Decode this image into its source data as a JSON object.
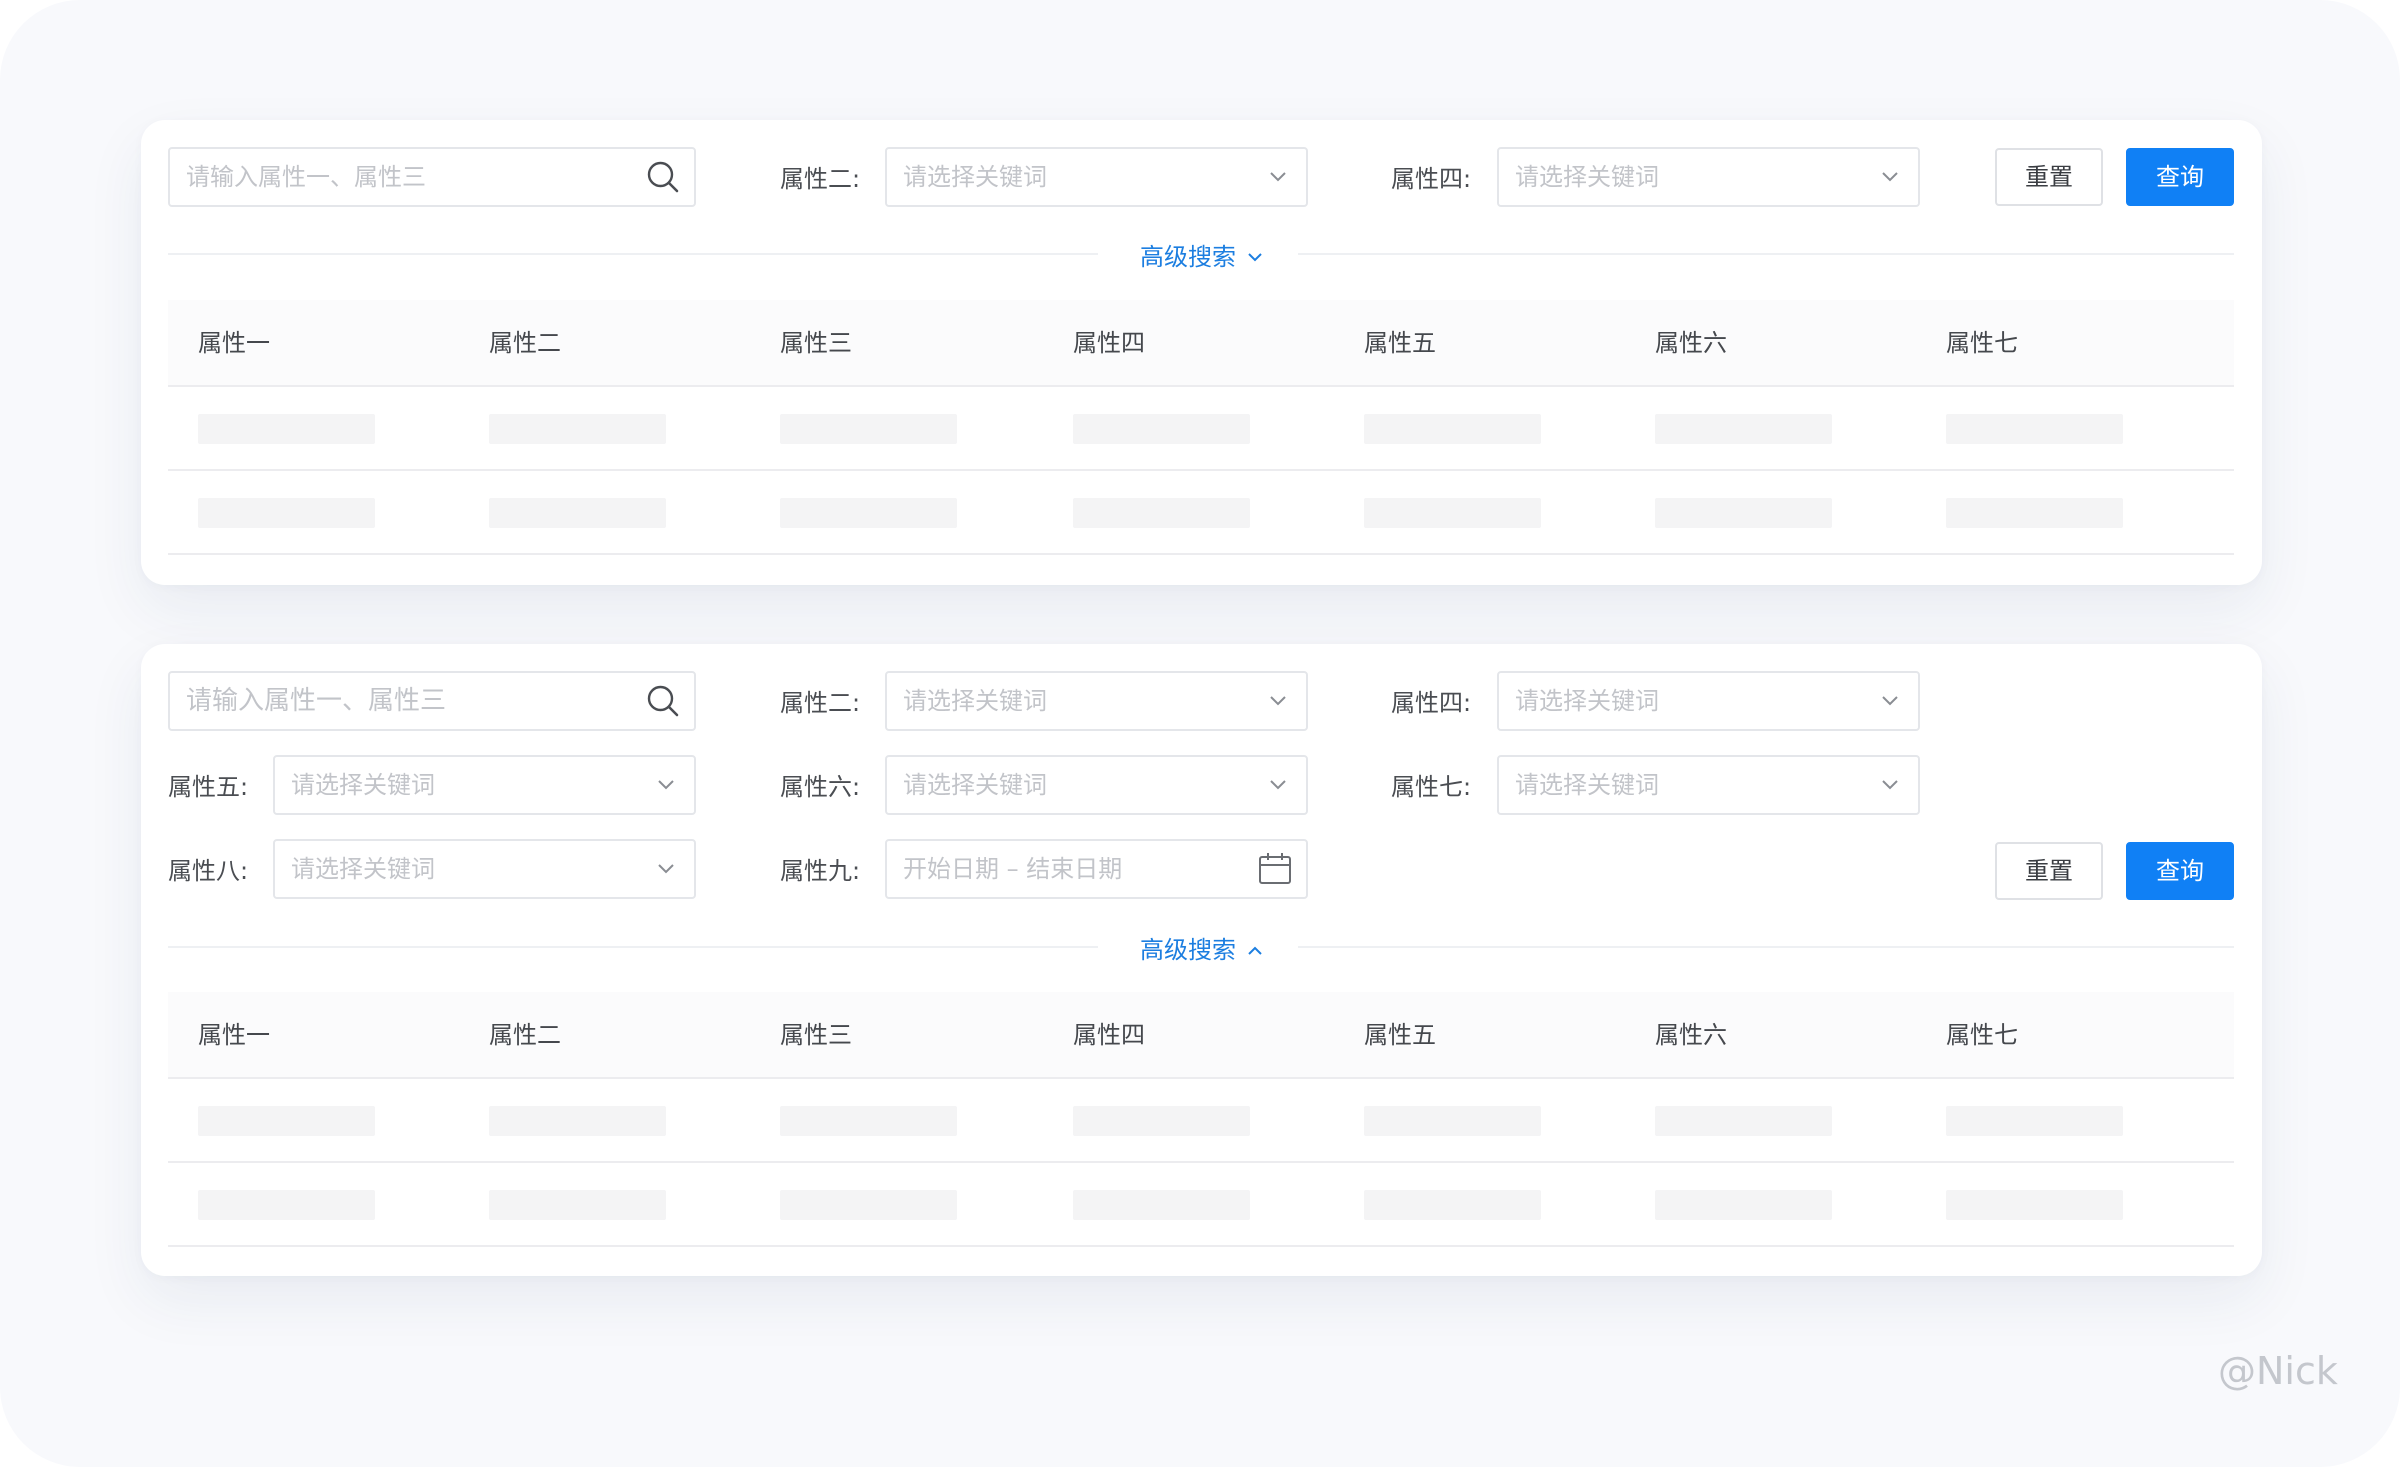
{
  "search_placeholder": "请输入属性一、属性三",
  "select_placeholder": "请选择关键词",
  "date_range_placeholder": "开始日期 – 结束日期",
  "labels": {
    "attr2": "属性二:",
    "attr4": "属性四:",
    "attr5": "属性五:",
    "attr6": "属性六:",
    "attr7": "属性七:",
    "attr8": "属性八:",
    "attr9": "属性九:"
  },
  "buttons": {
    "reset": "重置",
    "query": "查询"
  },
  "advanced_search": {
    "label": "高级搜索",
    "collapsed_icon": "chevron-down-icon",
    "expanded_icon": "chevron-up-icon"
  },
  "table": {
    "columns": [
      "属性一",
      "属性二",
      "属性三",
      "属性四",
      "属性五",
      "属性六",
      "属性七"
    ],
    "row_count": 2
  },
  "colors": {
    "primary": "#1080f5",
    "link": "#1c7ee0",
    "skeleton": "#f4f4f5"
  },
  "watermark": "@Nick"
}
